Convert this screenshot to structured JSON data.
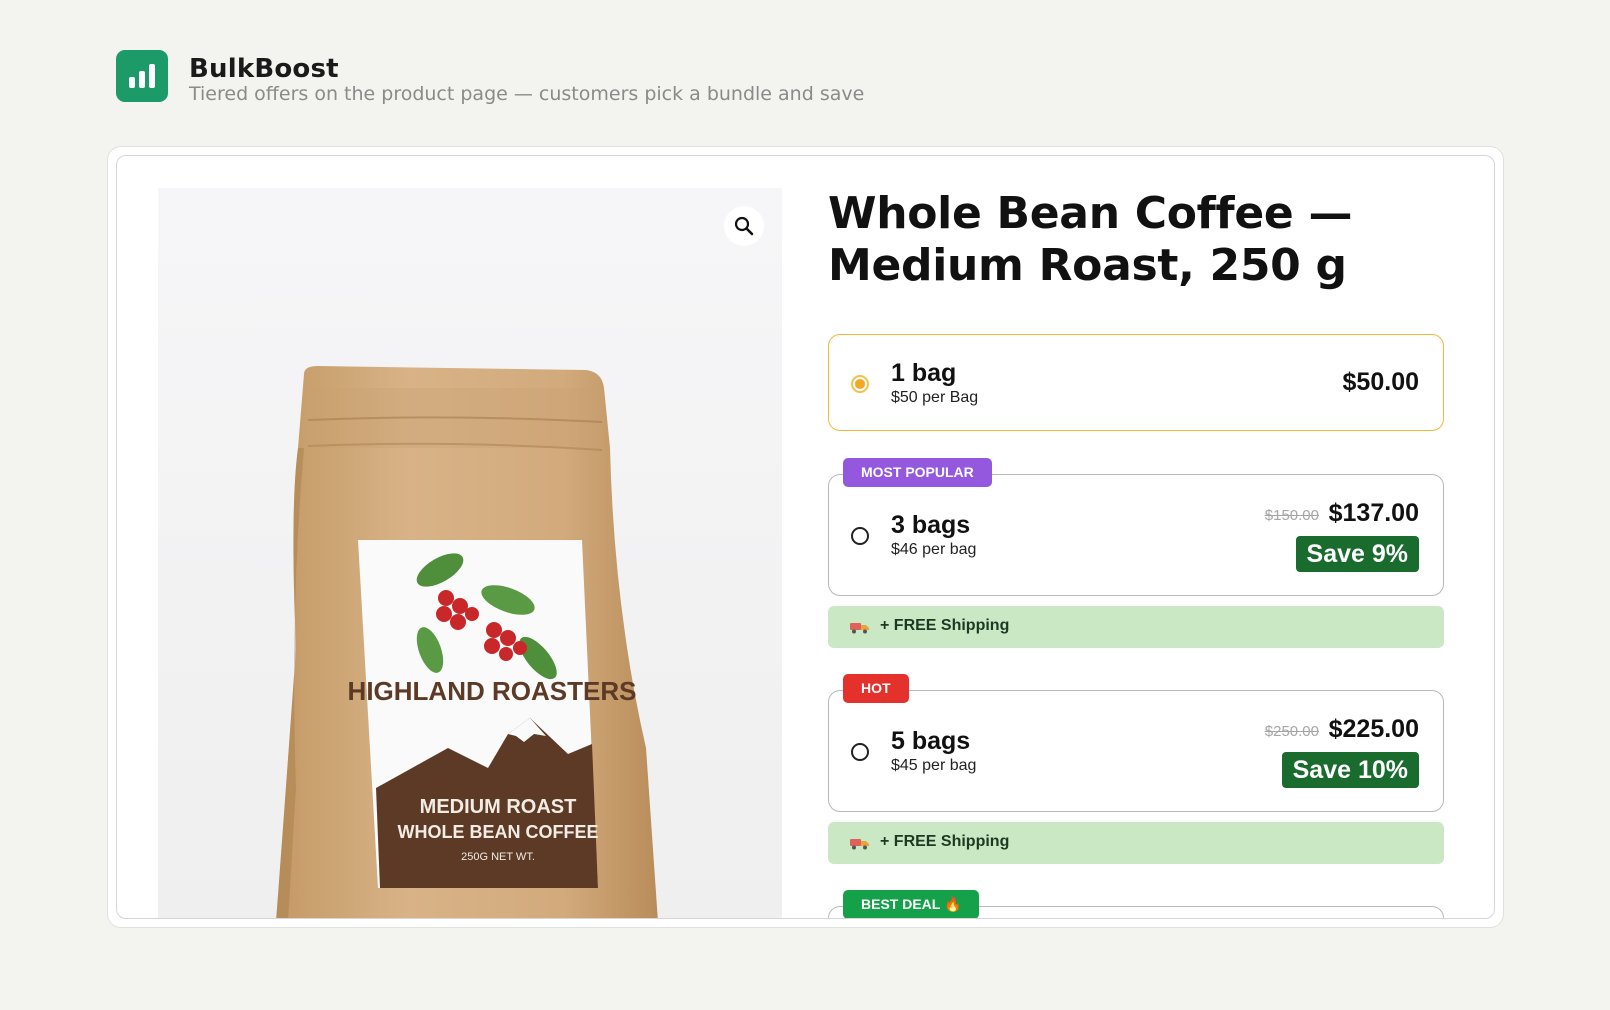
{
  "app": {
    "name": "BulkBoost",
    "tagline": "Tiered offers on the product page — customers pick a bundle and save",
    "icon": "bar-chart-icon",
    "brand_color": "#1c9b68"
  },
  "product": {
    "title": "Whole Bean Coffee — Medium Roast, 250 g",
    "image": {
      "brand": "HIGHLAND ROASTERS",
      "roast": "MEDIUM ROAST",
      "type": "WHOLE BEAN COFFEE",
      "weight": "250G NET WT."
    },
    "zoom_icon": "magnifier-icon"
  },
  "offers": [
    {
      "quantity": "1 bag",
      "unit_price": "$50 per Bag",
      "price": "$50.00",
      "selected": true
    },
    {
      "label": "MOST POPULAR",
      "label_color": "#9458de",
      "quantity": "3 bags",
      "unit_price": "$46 per bag",
      "compare_price": "$150.00",
      "price": "$137.00",
      "save": "Save 9%",
      "shipping": "+ FREE Shipping"
    },
    {
      "label": "HOT",
      "label_color": "#e5312c",
      "quantity": "5 bags",
      "unit_price": "$45 per bag",
      "compare_price": "$250.00",
      "price": "$225.00",
      "save": "Save 10%",
      "shipping": "+ FREE Shipping"
    },
    {
      "label": "BEST DEAL 🔥",
      "label_color": "#15a04a"
    }
  ],
  "colors": {
    "selected_border": "#f5b73a",
    "save_badge": "#1a6b2e",
    "shipping_bg": "#cbe8c5"
  }
}
